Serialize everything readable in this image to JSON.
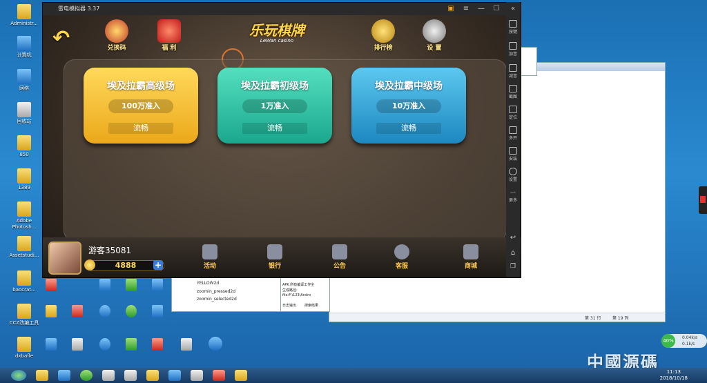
{
  "desktop_icons": [
    {
      "label": "Administr..."
    },
    {
      "label": "计算机"
    },
    {
      "label": "网络"
    },
    {
      "label": "回收站"
    },
    {
      "label": "850"
    },
    {
      "label": "1389"
    },
    {
      "label": "Adobe Photosh..."
    },
    {
      "label": "Assetstudi..."
    },
    {
      "label": "baocrat..."
    },
    {
      "label": "CCZ改编工具"
    },
    {
      "label": "dxbafle"
    }
  ],
  "emulator": {
    "title": "雷电模拟器 3.37",
    "window_controls": [
      "≡",
      "—",
      "☐",
      "✕",
      "«"
    ],
    "top_icons": {
      "redeem": "兑换码",
      "welfare": "福 利",
      "rank": "排行榜",
      "settings": "设 置"
    },
    "logo": {
      "main": "乐玩棋牌",
      "sub": "LeWan casino"
    },
    "rooms": [
      {
        "name": "埃及拉霸高级场",
        "entry": "100万准入",
        "status": "流畅",
        "color": "#f3bd2a"
      },
      {
        "name": "埃及拉霸初级场",
        "entry": "1万准入",
        "status": "流畅",
        "color": "#2fc7a7"
      },
      {
        "name": "埃及拉霸中级场",
        "entry": "10万准入",
        "status": "流畅",
        "color": "#36a9d8"
      }
    ],
    "player": {
      "name": "游客35081",
      "coins": "4888"
    },
    "bottom_nav": [
      "活动",
      "银行",
      "公告",
      "客服",
      "商城"
    ],
    "sidebar": [
      "按键",
      "加音",
      "减音",
      "截图",
      "定位",
      "多开",
      "安装",
      "设置",
      "更多"
    ]
  },
  "bg_windows": {
    "list_items": [
      "YELLOW2d",
      "zoomin_pressed2d",
      "zoomin_selected2d"
    ],
    "log_lines": [
      "APK 所有编译工作全",
      "生成路径:",
      "file:F:\\123\\Andro"
    ],
    "log_tabs": [
      "日志输出",
      "搜索结果"
    ],
    "status": [
      "第 31 行",
      "第 19 列"
    ]
  },
  "tray": {
    "battery": "40%",
    "speed_up": "0.04k/s",
    "speed_down": "0.1k/s",
    "time": "11:13",
    "date": "2018/10/18"
  },
  "watermark": "中國源碼"
}
